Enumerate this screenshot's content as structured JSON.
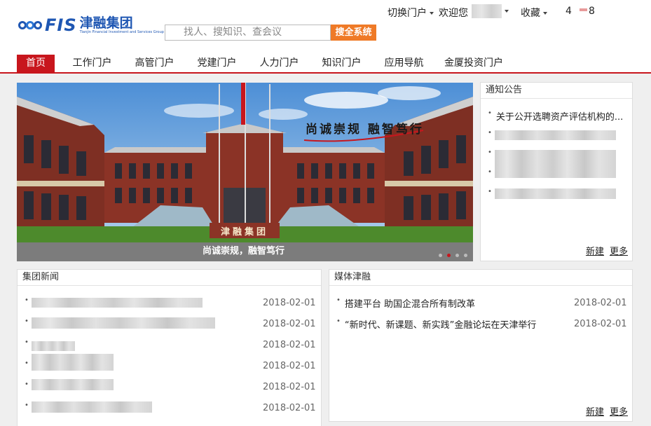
{
  "header": {
    "logo_en": "FIS",
    "logo_cn": "津融集团",
    "logo_sub": "Tianjin Financial Investment and Services Group",
    "search_placeholder": "找人、搜知识、查会议",
    "search_button": "搜全系统",
    "utility": {
      "switch_portal": "切换门户",
      "welcome": "欢迎您",
      "favorites": "收藏",
      "count_a": "4",
      "count_b": "8"
    }
  },
  "nav": {
    "items": [
      {
        "label": "首页",
        "active": true
      },
      {
        "label": "工作门户"
      },
      {
        "label": "高管门户"
      },
      {
        "label": "党建门户"
      },
      {
        "label": "人力门户"
      },
      {
        "label": "知识门户"
      },
      {
        "label": "应用导航"
      },
      {
        "label": "金厦投资门户"
      }
    ]
  },
  "banner": {
    "slogan": "尚诚崇规 融智笃行",
    "caption": "尚诚崇规，融智笃行",
    "building_sign": "津融集团",
    "slide_count": 4,
    "active_slide": 2
  },
  "notices": {
    "title": "通知公告",
    "items": [
      {
        "text": "关于公开选聘资产评估机构的..."
      }
    ],
    "new_label": "新建",
    "more_label": "更多"
  },
  "group_news": {
    "title": "集团新闻",
    "dates": [
      "2018-02-01",
      "2018-02-01",
      "2018-02-01",
      "2018-02-01",
      "2018-02-01",
      "2018-02-01"
    ]
  },
  "media": {
    "title": "媒体津融",
    "items": [
      {
        "text": "搭建平台 助国企混合所有制改革",
        "date": "2018-02-01"
      },
      {
        "text": "“新时代、新课题、新实践”金融论坛在天津举行",
        "date": "2018-02-01"
      }
    ],
    "new_label": "新建",
    "more_label": "更多"
  },
  "colors": {
    "brand_blue": "#1f57b3",
    "brand_red": "#c8161d",
    "search_orange": "#ef7a27"
  }
}
